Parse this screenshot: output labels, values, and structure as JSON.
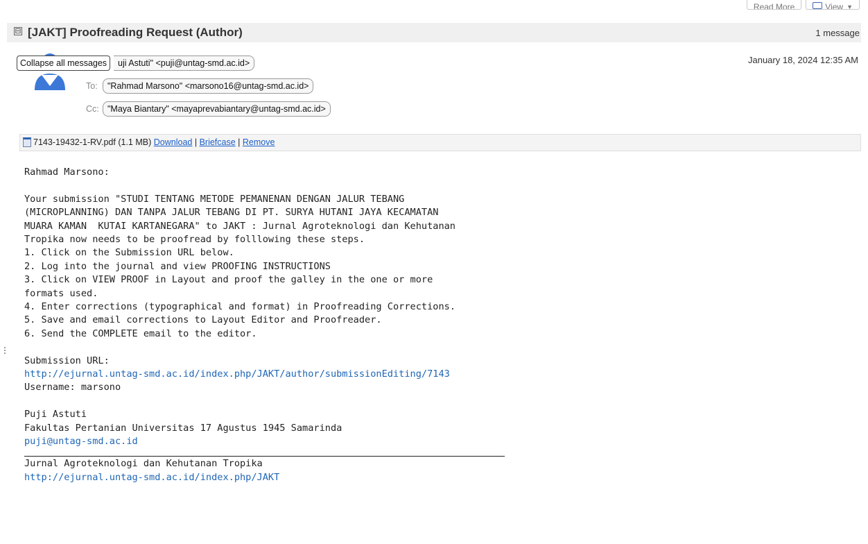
{
  "toolbar": {
    "read_more": "Read More",
    "view": "View"
  },
  "conversation": {
    "title": "[JAKT] Proofreading Request (Author)",
    "count": "1 message",
    "collapse_glyph": "⊟"
  },
  "tooltip": "Collapse all messages",
  "message": {
    "from": "\"Puji Astuti\" <puji@untag-smd.ac.id>",
    "from_visible": "uji Astuti\" <puji@untag-smd.ac.id>",
    "to_label": "To:",
    "to": "\"Rahmad Marsono\" <marsono16@untag-smd.ac.id>",
    "cc_label": "Cc:",
    "cc": "\"Maya Biantary\" <mayaprevabiantary@untag-smd.ac.id>",
    "date": "January 18, 2024 12:35 AM"
  },
  "attachment": {
    "filename": "7143-19432-1-RV.pdf",
    "size": "(1.1 MB)",
    "download": "Download",
    "briefcase": "Briefcase",
    "remove": "Remove",
    "sep": "|"
  },
  "body": {
    "salutation": "Rahmad Marsono:",
    "para": [
      "Your submission \"STUDI TENTANG METODE PEMANENAN DENGAN JALUR TEBANG",
      "(MICROPLANNING) DAN TANPA JALUR TEBANG DI PT. SURYA HUTANI JAYA KECAMATAN",
      "MUARA KAMAN  KUTAI KARTANEGARA\" to JAKT : Jurnal Agroteknologi dan Kehutanan",
      "Tropika now needs to be proofread by folllowing these steps.",
      "1. Click on the Submission URL below.",
      "2. Log into the journal and view PROOFING INSTRUCTIONS",
      "3. Click on VIEW PROOF in Layout and proof the galley in the one or more",
      "formats used.",
      "4. Enter corrections (typographical and format) in Proofreading Corrections.",
      "5. Save and email corrections to Layout Editor and Proofreader.",
      "6. Send the COMPLETE email to the editor."
    ],
    "url_label": "Submission URL:",
    "url": "http://ejurnal.untag-smd.ac.id/index.php/JAKT/author/submissionEditing/7143",
    "username": "Username: marsono",
    "sig_name": "Puji Astuti",
    "sig_org": "Fakultas Pertanian Universitas 17 Agustus 1945 Samarinda",
    "sig_email": "puji@untag-smd.ac.id",
    "footer_journal": "Jurnal Agroteknologi dan Kehutanan Tropika",
    "footer_url": "http://ejurnal.untag-smd.ac.id/index.php/JAKT"
  }
}
